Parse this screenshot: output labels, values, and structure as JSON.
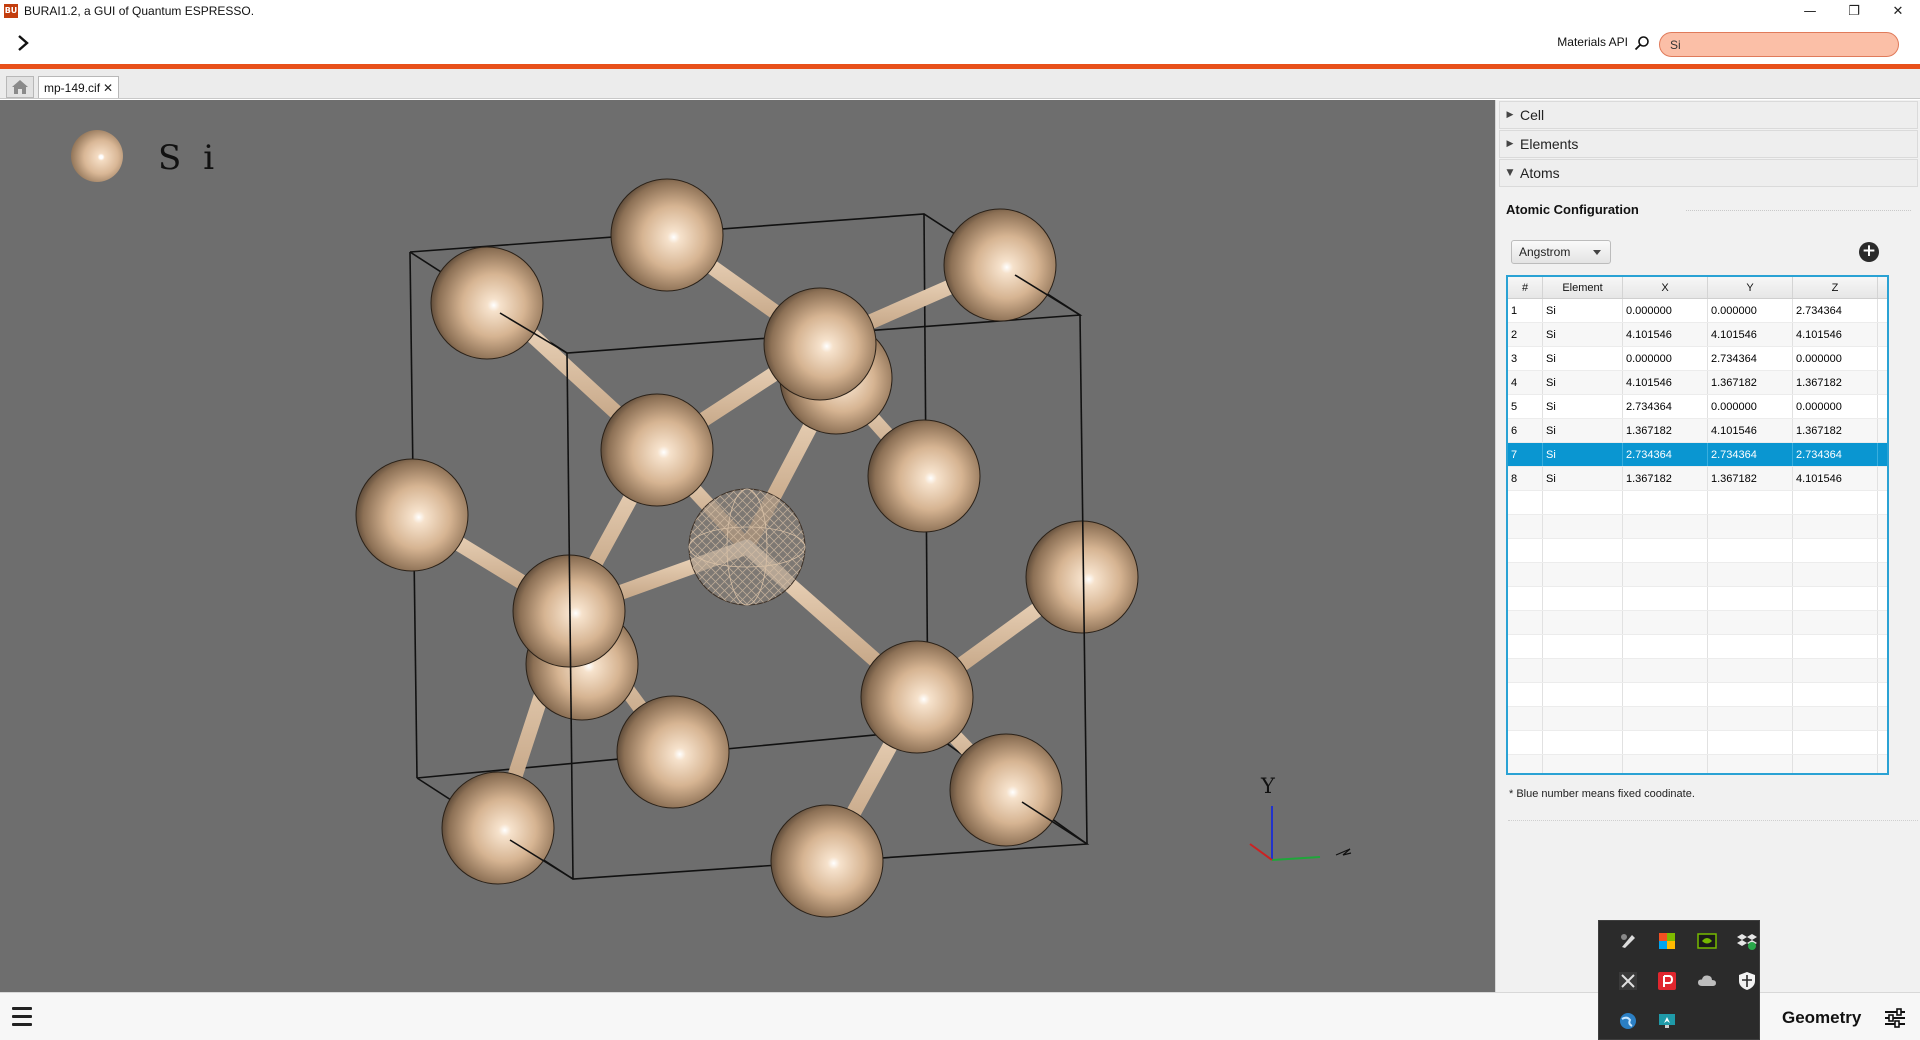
{
  "window": {
    "title": "BURAI1.2, a GUI of Quantum ESPRESSO.",
    "logo_text": "BU",
    "minimize": "—",
    "restore": "❐",
    "close": "✕"
  },
  "toolbar": {
    "expand_icon": "chevron-right-icon",
    "api_label": "Materials API",
    "search_value": "Si",
    "accent_color": "#e8501a"
  },
  "tabs": {
    "home_icon": "home-icon",
    "file_tab_label": "mp-149.cif",
    "close_glyph": "✕"
  },
  "viewer": {
    "legend_element": "Si",
    "axis_label": "Y",
    "atom_color": "#d9b796",
    "background": "#6e6e6e"
  },
  "panel": {
    "accordions": [
      {
        "label": "Cell",
        "expanded": false
      },
      {
        "label": "Elements",
        "expanded": false
      },
      {
        "label": "Atoms",
        "expanded": true
      }
    ],
    "section_title": "Atomic Configuration",
    "unit_select": "Angstrom",
    "add_button": "+",
    "table": {
      "headers": [
        "#",
        "Element",
        "X",
        "Y",
        "Z"
      ],
      "rows": [
        {
          "num": "1",
          "element": "Si",
          "x": "0.000000",
          "y": "0.000000",
          "z": "2.734364"
        },
        {
          "num": "2",
          "element": "Si",
          "x": "4.101546",
          "y": "4.101546",
          "z": "4.101546"
        },
        {
          "num": "3",
          "element": "Si",
          "x": "0.000000",
          "y": "2.734364",
          "z": "0.000000"
        },
        {
          "num": "4",
          "element": "Si",
          "x": "4.101546",
          "y": "1.367182",
          "z": "1.367182"
        },
        {
          "num": "5",
          "element": "Si",
          "x": "2.734364",
          "y": "0.000000",
          "z": "0.000000"
        },
        {
          "num": "6",
          "element": "Si",
          "x": "1.367182",
          "y": "4.101546",
          "z": "1.367182"
        },
        {
          "num": "7",
          "element": "Si",
          "x": "2.734364",
          "y": "2.734364",
          "z": "2.734364",
          "selected": true
        },
        {
          "num": "8",
          "element": "Si",
          "x": "1.367182",
          "y": "1.367182",
          "z": "4.101546"
        }
      ],
      "selection_color": "#0a96d1"
    },
    "note": "* Blue number means fixed coodinate."
  },
  "statusbar": {
    "menu_icon": "hamburger-menu-icon",
    "mode_label": "Geometry",
    "settings_icon": "sliders-icon"
  },
  "tray": {
    "icons": [
      "pen-tablet-icon",
      "office-icon",
      "nvidia-icon",
      "dropbox-icon",
      "x-app-icon",
      "p-app-icon",
      "cloud-icon",
      "shield-icon",
      "globe-icon",
      "display-icon"
    ]
  }
}
